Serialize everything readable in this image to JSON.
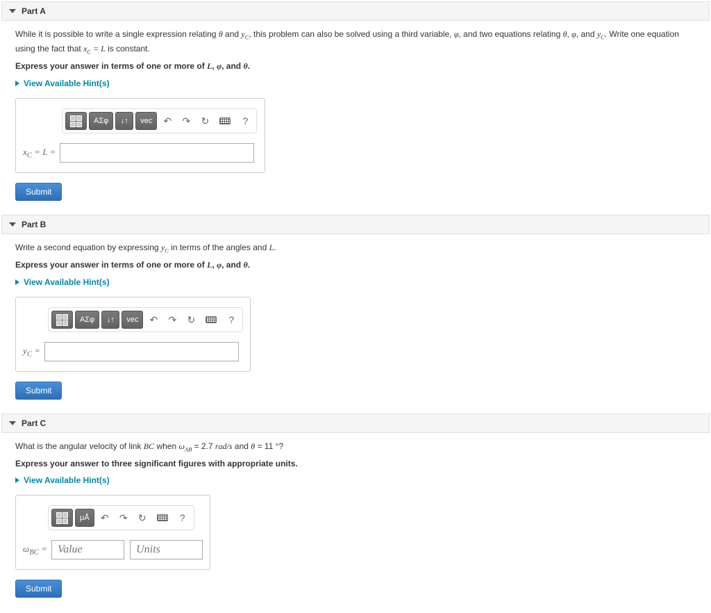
{
  "parts": {
    "a": {
      "title": "Part A",
      "question_pre": "While it is possible to write a single expression relating ",
      "question_mid1": " and ",
      "question_mid2": ", this problem can also be solved using a third variable, ",
      "question_mid3": ", and two equations relating ",
      "question_mid4": ", ",
      "question_mid5": ", and ",
      "question_mid6": ". Write one equation using the fact that ",
      "question_mid7": " is constant.",
      "instruction_pre": "Express your answer in terms of one or more of ",
      "instruction_mid1": ", ",
      "instruction_mid2": ", and ",
      "instruction_end": ".",
      "answer_label": "x_C = L =",
      "answer_eq": " = "
    },
    "b": {
      "title": "Part B",
      "question_pre": "Write a second equation by expressing ",
      "question_mid1": " in terms of the angles and ",
      "question_end": ".",
      "instruction_pre": "Express your answer in terms of one or more of ",
      "instruction_mid1": ", ",
      "instruction_mid2": ", and ",
      "instruction_end": ".",
      "answer_label": "y_C",
      "answer_eq": " = "
    },
    "c": {
      "title": "Part C",
      "question_pre": "What is the angular velocity of link ",
      "question_mid1": " when ",
      "question_val1": " = 2.7 rad/s",
      "question_mid2": " and ",
      "question_val2": " = 11 °",
      "question_end": "?",
      "instruction": "Express your answer to three significant figures with appropriate units.",
      "answer_label": "ω_BC",
      "answer_eq": " = ",
      "value_placeholder": "Value",
      "units_placeholder": "Units"
    }
  },
  "shared": {
    "hint_label": "View Available Hint(s)",
    "submit_label": "Submit",
    "toolbar": {
      "templates": "templates",
      "greek": "ΑΣφ",
      "arrows": "↓↑",
      "vec": "vec",
      "units_btn": "μÅ",
      "undo": "↶",
      "redo": "↷",
      "reset": "↻",
      "keyboard": "keyboard",
      "help": "?"
    }
  },
  "symbols": {
    "theta": "θ",
    "phi": "φ",
    "L": "L",
    "xC": "x_C",
    "yC": "y_C",
    "BC": "BC",
    "omegaAB": "ω_AB",
    "omegaBC": "ω_BC",
    "eq": " = "
  }
}
